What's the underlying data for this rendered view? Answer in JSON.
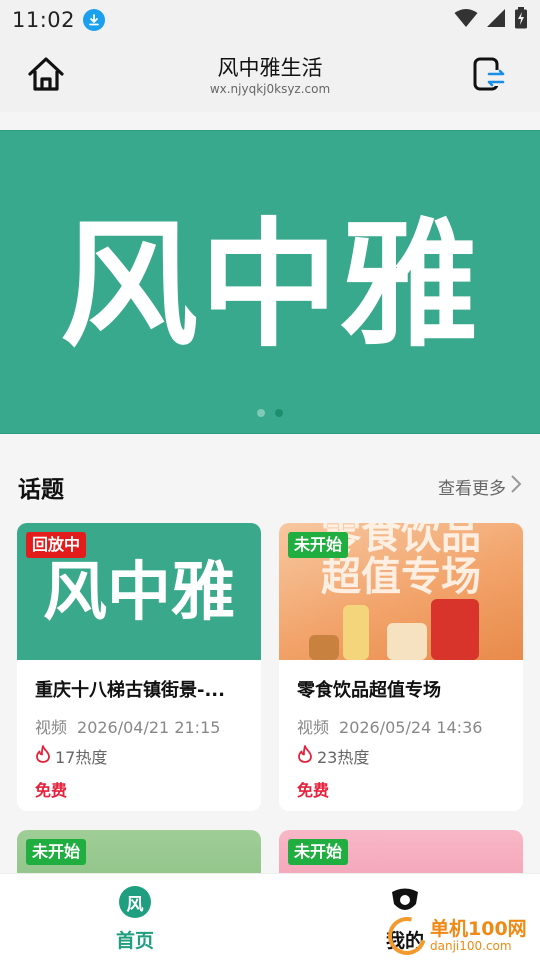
{
  "status_bar": {
    "time": "11:02",
    "icons": [
      "download-icon",
      "wifi-icon",
      "signal-icon",
      "battery-charging-icon"
    ]
  },
  "header": {
    "title": "风中雅生活",
    "subtitle": "wx.njyqkj0ksyz.com",
    "left_icon": "home-icon",
    "right_icon": "switch-account-icon"
  },
  "banner": {
    "logo_text": "风中雅",
    "background": "#38a98c",
    "dots": 2,
    "active_dot": 1
  },
  "topics": {
    "title": "话题",
    "more_label": "查看更多"
  },
  "cards": [
    {
      "badge": "回放中",
      "thumb_text": "风中雅",
      "title": "重庆十八梯古镇街景-...",
      "type": "视频",
      "datetime": "2026/04/21 21:15",
      "heat": "17热度",
      "price": "免费"
    },
    {
      "badge": "未开始",
      "thumb_text_1": "零食饮品",
      "thumb_text_2": "超值专场",
      "title": "零食饮品超值专场",
      "type": "视频",
      "datetime": "2026/05/24 14:36",
      "heat": "23热度",
      "price": "免费"
    },
    {
      "badge": "未开始"
    },
    {
      "badge": "未开始"
    }
  ],
  "tabbar": {
    "home_icon_char": "风",
    "home_label": "首页",
    "mine_label": "我的"
  },
  "watermark": {
    "main": "单机100网",
    "sub": "danji100.com"
  },
  "colors": {
    "brand": "#1f9e80",
    "replay_badge": "#e41c1c",
    "pending_badge": "#1fae3f",
    "price": "#e7213b",
    "heat_icon": "#e7213b"
  }
}
